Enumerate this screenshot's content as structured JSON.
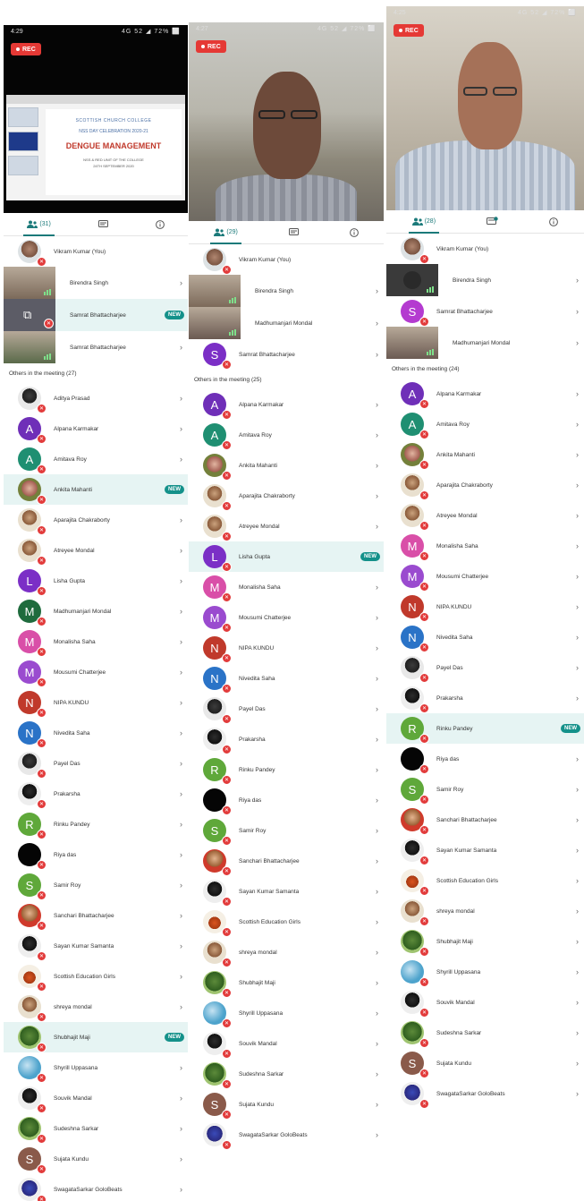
{
  "colors": {
    "accent": "#1b7a7a",
    "new_badge": "#14918a",
    "mute": "#e23b3b",
    "highlight": "#e6f4f3",
    "rec": "#e53935"
  },
  "panels": [
    {
      "status": {
        "time": "4:29",
        "right": "4G 52 ◢ 72% ⬜"
      },
      "rec_label": "REC",
      "slide": {
        "line1": "SCOTTISH CHURCH COLLEGE",
        "line2": "NSS DAY CELEBRATION 2020-21",
        "line3": "DENGUE MANAGEMENT",
        "line4": "NSS & RED UNIT OF THE COLLEGE",
        "line5": "24TH SEPTEMBER 2020"
      },
      "tabs": {
        "participants": "(31)"
      },
      "pinned": [
        {
          "name": "Vikram Kumar (You)",
          "kind": "photo",
          "ph": "ph1",
          "chev": ""
        },
        {
          "name": "Birendra Singh",
          "kind": "video",
          "tone": "#7c6a5a",
          "chev": "›"
        },
        {
          "name": "Samrat Bhattacharjee",
          "kind": "share",
          "chev": "",
          "badge": "NEW"
        },
        {
          "name": "Samrat Bhattacharjee",
          "kind": "video",
          "tone": "#5a6a4a",
          "chev": "›"
        }
      ],
      "others_title": "Others in the meeting (27)",
      "others": [
        {
          "name": "Aditya Prasad",
          "ph": "ph4"
        },
        {
          "name": "Alpana Karmakar",
          "letter": "A",
          "color": "#6f2fb8"
        },
        {
          "name": "Amitava Roy",
          "letter": "A",
          "color": "#1f8f72"
        },
        {
          "name": "Ankita Mahanti",
          "ph": "ph3",
          "badge": "NEW"
        },
        {
          "name": "Aparajita Chakraborty",
          "ph": "ph2"
        },
        {
          "name": "Atreyee Mondal",
          "ph": "ph2"
        },
        {
          "name": "Lisha Gupta",
          "letter": "L",
          "color": "#7b2fc6"
        },
        {
          "name": "Madhumanjari Mondal",
          "letter": "M",
          "color": "#1f6b3d"
        },
        {
          "name": "Monalisha Saha",
          "letter": "M",
          "color": "#d94fa8"
        },
        {
          "name": "Mousumi Chatterjee",
          "letter": "M",
          "color": "#9a4bcf"
        },
        {
          "name": "NIPA KUNDU",
          "letter": "N",
          "color": "#c0392b"
        },
        {
          "name": "Nivedita Saha",
          "letter": "N",
          "color": "#2a73c7"
        },
        {
          "name": "Payel Das",
          "ph": "ph4"
        },
        {
          "name": "Prakarsha",
          "ph": "ph10"
        },
        {
          "name": "Rinku Pandey",
          "letter": "R",
          "color": "#5fa83a"
        },
        {
          "name": "Riya das",
          "ph": "ph9"
        },
        {
          "name": "Samir Roy",
          "letter": "S",
          "color": "#5fa83a"
        },
        {
          "name": "Sanchari Bhattacharjee",
          "ph": "ph8"
        },
        {
          "name": "Sayan Kumar Samanta",
          "ph": "ph10"
        },
        {
          "name": "Scottish Education Girls",
          "ph": "ph7"
        },
        {
          "name": "shreya mondal",
          "ph": "ph2"
        },
        {
          "name": "Shubhajit Maji",
          "ph": "ph5",
          "badge": "NEW"
        },
        {
          "name": "Shyrill Uppasana",
          "ph": "ph6"
        },
        {
          "name": "Souvik Mandal",
          "ph": "ph10"
        },
        {
          "name": "Sudeshna Sarkar",
          "ph": "ph5"
        },
        {
          "name": "Sujata Kundu",
          "letter": "S",
          "color": "#8a5a4a"
        },
        {
          "name": "SwagataSarkar GoloBeats",
          "ph": "ph11"
        }
      ]
    },
    {
      "status": {
        "time": "4:27",
        "right": "4G 52 ◢ 72% ⬜"
      },
      "rec_label": "REC",
      "tabs": {
        "participants": "(29)"
      },
      "pinned": [
        {
          "name": "Vikram Kumar (You)",
          "kind": "photo",
          "ph": "ph1",
          "chev": ""
        },
        {
          "name": "Birendra Singh",
          "kind": "video",
          "tone": "#7c6a5a",
          "chev": "›"
        },
        {
          "name": "Madhumanjari Mondal",
          "kind": "video",
          "tone": "#6b5a52",
          "chev": "›"
        },
        {
          "name": "Samrat Bhattacharjee",
          "kind": "letter",
          "letter": "S",
          "color": "#7b2fc6",
          "chev": "›"
        }
      ],
      "others_title": "Others in the meeting (25)",
      "others": [
        {
          "name": "Alpana Karmakar",
          "letter": "A",
          "color": "#6f2fb8"
        },
        {
          "name": "Amitava Roy",
          "letter": "A",
          "color": "#1f8f72"
        },
        {
          "name": "Ankita Mahanti",
          "ph": "ph3"
        },
        {
          "name": "Aparajita Chakraborty",
          "ph": "ph2"
        },
        {
          "name": "Atreyee Mondal",
          "ph": "ph2"
        },
        {
          "name": "Lisha Gupta",
          "letter": "L",
          "color": "#7b2fc6",
          "badge": "NEW"
        },
        {
          "name": "Monalisha Saha",
          "letter": "M",
          "color": "#d94fa8"
        },
        {
          "name": "Mousumi Chatterjee",
          "letter": "M",
          "color": "#9a4bcf"
        },
        {
          "name": "NIPA KUNDU",
          "letter": "N",
          "color": "#c0392b"
        },
        {
          "name": "Nivedita Saha",
          "letter": "N",
          "color": "#2a73c7"
        },
        {
          "name": "Payel Das",
          "ph": "ph4"
        },
        {
          "name": "Prakarsha",
          "ph": "ph10"
        },
        {
          "name": "Rinku Pandey",
          "letter": "R",
          "color": "#5fa83a"
        },
        {
          "name": "Riya das",
          "ph": "ph9"
        },
        {
          "name": "Samir Roy",
          "letter": "S",
          "color": "#5fa83a"
        },
        {
          "name": "Sanchari Bhattacharjee",
          "ph": "ph8"
        },
        {
          "name": "Sayan Kumar Samanta",
          "ph": "ph10"
        },
        {
          "name": "Scottish Education Girls",
          "ph": "ph7"
        },
        {
          "name": "shreya mondal",
          "ph": "ph2"
        },
        {
          "name": "Shubhajit Maji",
          "ph": "ph5"
        },
        {
          "name": "Shyrill Uppasana",
          "ph": "ph6"
        },
        {
          "name": "Souvik Mandal",
          "ph": "ph10"
        },
        {
          "name": "Sudeshna Sarkar",
          "ph": "ph5"
        },
        {
          "name": "Sujata Kundu",
          "letter": "S",
          "color": "#8a5a4a"
        },
        {
          "name": "SwagataSarkar GoloBeats",
          "ph": "ph11"
        }
      ]
    },
    {
      "status": {
        "time": "4:25",
        "right": "4G 52 ◢ 72% ⬜"
      },
      "rec_label": "REC",
      "tabs": {
        "participants": "(28)"
      },
      "pinned": [
        {
          "name": "Vikram Kumar (You)",
          "kind": "photo",
          "ph": "ph1",
          "chev": ""
        },
        {
          "name": "Birendra Singh",
          "kind": "dark",
          "chev": "›"
        },
        {
          "name": "Samrat Bhattacharjee",
          "kind": "letter",
          "letter": "S",
          "color": "#b43bd0",
          "chev": "›"
        },
        {
          "name": "Madhumanjari Mondal",
          "kind": "video",
          "tone": "#6b5a52",
          "chev": "›"
        }
      ],
      "others_title": "Others in the meeting (24)",
      "others": [
        {
          "name": "Alpana Karmakar",
          "letter": "A",
          "color": "#6f2fb8"
        },
        {
          "name": "Amitava Roy",
          "letter": "A",
          "color": "#1f8f72"
        },
        {
          "name": "Ankita Mahanti",
          "ph": "ph3"
        },
        {
          "name": "Aparajita Chakraborty",
          "ph": "ph2"
        },
        {
          "name": "Atreyee Mondal",
          "ph": "ph2"
        },
        {
          "name": "Monalisha Saha",
          "letter": "M",
          "color": "#d94fa8"
        },
        {
          "name": "Mousumi Chatterjee",
          "letter": "M",
          "color": "#9a4bcf"
        },
        {
          "name": "NIPA KUNDU",
          "letter": "N",
          "color": "#c0392b"
        },
        {
          "name": "Nivedita Saha",
          "letter": "N",
          "color": "#2a73c7"
        },
        {
          "name": "Payel Das",
          "ph": "ph4"
        },
        {
          "name": "Prakarsha",
          "ph": "ph10"
        },
        {
          "name": "Rinku Pandey",
          "letter": "R",
          "color": "#5fa83a",
          "badge": "NEW"
        },
        {
          "name": "Riya das",
          "ph": "ph9"
        },
        {
          "name": "Samir Roy",
          "letter": "S",
          "color": "#5fa83a"
        },
        {
          "name": "Sanchari Bhattacharjee",
          "ph": "ph8"
        },
        {
          "name": "Sayan Kumar Samanta",
          "ph": "ph10"
        },
        {
          "name": "Scottish Education Girls",
          "ph": "ph7"
        },
        {
          "name": "shreya mondal",
          "ph": "ph2"
        },
        {
          "name": "Shubhajit Maji",
          "ph": "ph5"
        },
        {
          "name": "Shyrill Uppasana",
          "ph": "ph6"
        },
        {
          "name": "Souvik Mandal",
          "ph": "ph10"
        },
        {
          "name": "Sudeshna Sarkar",
          "ph": "ph5"
        },
        {
          "name": "Sujata Kundu",
          "letter": "S",
          "color": "#8a5a4a"
        },
        {
          "name": "SwagataSarkar GoloBeats",
          "ph": "ph11"
        }
      ]
    }
  ]
}
